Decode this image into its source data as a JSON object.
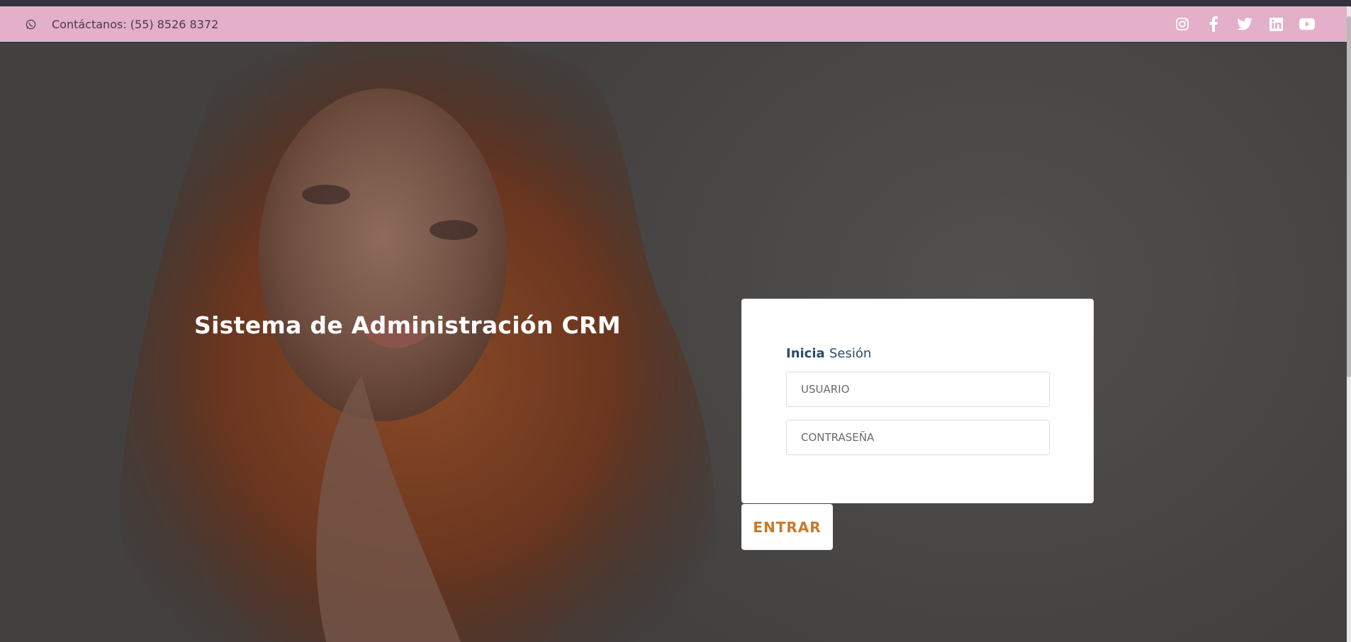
{
  "topbar": {
    "contact_text": "Contáctanos: (55) 8526 8372",
    "whatsapp_icon": "whatsapp-icon",
    "social_icons": [
      "instagram-icon",
      "facebook-icon",
      "twitter-icon",
      "linkedin-icon",
      "youtube-icon"
    ],
    "background_color": "#e3afc9"
  },
  "hero": {
    "headline": "Sistema de Administración CRM"
  },
  "login": {
    "title_part1": "Inicia",
    "title_part2": "Sesión",
    "username_placeholder": "USUARIO",
    "password_placeholder": "CONTRASEÑA",
    "submit_label": "ENTRAR",
    "submit_color": "#c97a2a"
  }
}
